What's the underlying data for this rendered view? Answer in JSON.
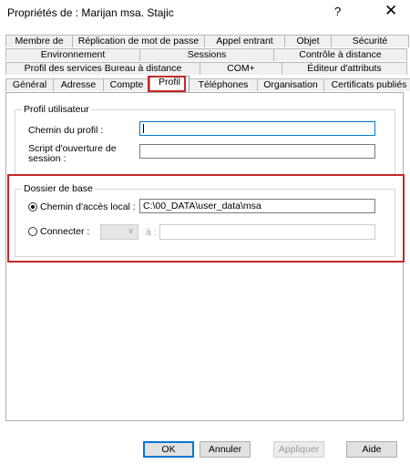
{
  "window": {
    "title": "Propriétés de : Marijan msa. Stajic",
    "help_glyph": "?",
    "close_glyph": "✕"
  },
  "tabs": {
    "row1": [
      "Membre de",
      "Réplication de mot de passe",
      "Appel entrant",
      "Objet",
      "Sécurité"
    ],
    "row2": [
      "Environnement",
      "Sessions",
      "Contrôle à distance"
    ],
    "row3": [
      "Profil des services Bureau à distance",
      "COM+",
      "Éditeur d'attributs"
    ],
    "row4": [
      "Général",
      "Adresse",
      "Compte",
      "Profil",
      "Téléphones",
      "Organisation",
      "Certificats publiés"
    ],
    "active": "Profil"
  },
  "profile_group": {
    "legend": "Profil utilisateur",
    "profile_path_label": "Chemin du profil :",
    "profile_path_value": "",
    "logon_script_label_line1": "Script d'ouverture de",
    "logon_script_label_line2": "session :",
    "logon_script_value": ""
  },
  "home_group": {
    "legend": "Dossier de base",
    "local_path_label": "Chemin d'accès local :",
    "local_path_value": "C:\\00_DATA\\user_data\\msa",
    "local_path_selected": true,
    "connect_label": "Connecter :",
    "drive_value": "",
    "to_label": "à :",
    "to_value": ""
  },
  "buttons": {
    "ok": "OK",
    "cancel": "Annuler",
    "apply": "Appliquer",
    "help": "Aide"
  },
  "colors": {
    "highlight": "#c62828",
    "focus_border": "#0078d7"
  }
}
